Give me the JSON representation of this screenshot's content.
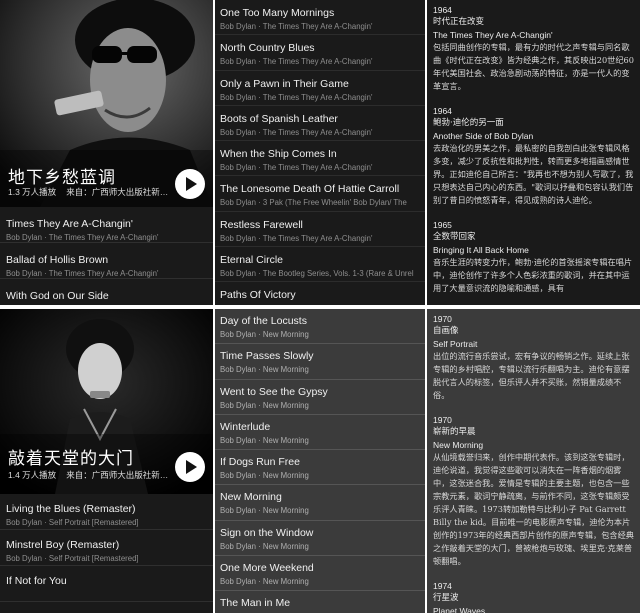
{
  "playlist_top": {
    "title": "地下乡愁蓝调",
    "plays": "1.3 万人播放",
    "source": "来自：广西师大出版社新…"
  },
  "playlist_bottom": {
    "title": "敲着天堂的大门",
    "plays": "1.4 万人播放",
    "source": "来自：广西师大出版社新…"
  },
  "left_top_songs": [
    {
      "title": "Times They Are A-Changin'",
      "subtitle": "Bob Dylan · The Times They Are A-Changin'"
    },
    {
      "title": "Ballad of Hollis Brown",
      "subtitle": "Bob Dylan · The Times They Are A-Changin'"
    },
    {
      "title": "With God on Our Side",
      "subtitle": ""
    }
  ],
  "left_bottom_songs": [
    {
      "title": "Living the Blues (Remaster)",
      "subtitle": "Bob Dylan · Self Portrait [Remastered]"
    },
    {
      "title": "Minstrel Boy (Remaster)",
      "subtitle": "Bob Dylan · Self Portrait [Remastered]"
    },
    {
      "title": "If Not for You",
      "subtitle": ""
    }
  ],
  "mid_top_songs": [
    {
      "title": "One Too Many Mornings",
      "subtitle": "Bob Dylan · The Times They Are A-Changin'"
    },
    {
      "title": "North Country Blues",
      "subtitle": "Bob Dylan · The Times They Are A-Changin'"
    },
    {
      "title": "Only a Pawn in Their Game",
      "subtitle": "Bob Dylan · The Times They Are A-Changin'"
    },
    {
      "title": "Boots of Spanish Leather",
      "subtitle": "Bob Dylan · The Times They Are A-Changin'"
    },
    {
      "title": "When the Ship Comes In",
      "subtitle": "Bob Dylan · The Times They Are A-Changin'"
    },
    {
      "title": "The Lonesome Death Of Hattie Carroll",
      "subtitle": "Bob Dylan · 3 Pak (The Free Wheelin' Bob Dylan/ The"
    },
    {
      "title": "Restless Farewell",
      "subtitle": "Bob Dylan · The Times They Are A-Changin'"
    },
    {
      "title": "Eternal Circle",
      "subtitle": "Bob Dylan · The Bootleg Series, Vols. 1-3 (Rare & Unrel"
    },
    {
      "title": "Paths Of Victory",
      "subtitle": ""
    }
  ],
  "mid_bottom_songs": [
    {
      "title": "Day of the Locusts",
      "subtitle": "Bob Dylan · New Morning"
    },
    {
      "title": "Time Passes Slowly",
      "subtitle": "Bob Dylan · New Morning"
    },
    {
      "title": "Went to See the Gypsy",
      "subtitle": "Bob Dylan · New Morning"
    },
    {
      "title": "Winterlude",
      "subtitle": "Bob Dylan · New Morning"
    },
    {
      "title": "If Dogs Run Free",
      "subtitle": "Bob Dylan · New Morning"
    },
    {
      "title": "New Morning",
      "subtitle": "Bob Dylan · New Morning"
    },
    {
      "title": "Sign on the Window",
      "subtitle": "Bob Dylan · New Morning"
    },
    {
      "title": "One More Weekend",
      "subtitle": "Bob Dylan · New Morning"
    },
    {
      "title": "The Man in Me",
      "subtitle": ""
    }
  ],
  "right_top": [
    {
      "year": "1964",
      "title_cn": "时代正在改变",
      "title_en": "The Times They Are A-Changin'",
      "desc": "包括同曲创作的专辑，最有力的时代之声专辑与同名歌曲《时代正在改变》皆为经典之作，其反映出20世纪60年代美国社会、政治急剧动荡的特征，亦是一代人的变革宣言。"
    },
    {
      "year": "1964",
      "title_cn": "鲍勃·迪伦的另一面",
      "title_en": "Another Side of Bob Dylan",
      "desc": "去政治化的男美之作，最私密的自我剖白此张专辑风格多变，减少了反抗性和批判性，转而更多地描画感情世界。正如迪伦自己所言：\"我再也不想为别人写歌了，我只想表达自己内心的东西。\"歌词以抒叠和包容认我们告别了昔日的愤怒青年，得见成熟的诗人迪伦。"
    },
    {
      "year": "1965",
      "title_cn": "全数带回家",
      "title_en": "Bringing It All Back Home",
      "desc": "音乐生涯的转变力作，鲍勃·迪伦的首张摇滚专辑在唱片中，迪伦创作了许多个人色彩浓重的歌词，并在其中运用了大量意识流的隐喻和通感，具有"
    }
  ],
  "right_bottom": [
    {
      "year": "1970",
      "title_cn": "自画像",
      "title_en": "Self Portrait",
      "desc": "出位的流行音乐尝试，宏有争议的畅销之作。延续上张专辑的乡村唱腔，专辑以流行乐翻唱为主。迪伦有意摆脱代言人的标签，但乐评人并不买账，然销量成绩不俗。"
    },
    {
      "year": "1970",
      "title_cn": "崭新的早晨",
      "title_en": "New Morning",
      "desc": "从仙境载誉归来，创作中期代表作。该到这张专辑时，迪伦说道，我觉得这些歌可以消失在一阵香烟的烟雾中，这张迷合我。爱情是专辑的主要主题，也包含一些宗教元素，歌词宁静疏离，与前作不同，这张专辑颇受乐评人青睐。1973转加勒特与比利小子 Pat Garrett Billy the kid。目前唯一的电影原声专辑，迪伦为本片创作的1973年的经典西部片创作的原声专辑，包含经典之作敲着天堂的大门，曾被枪炮与玫瑰、埃里克·克莱普顿翻唱。"
    },
    {
      "year": "1974",
      "title_cn": "行星波",
      "title_en": "Planet Waves",
      "desc": ""
    }
  ]
}
